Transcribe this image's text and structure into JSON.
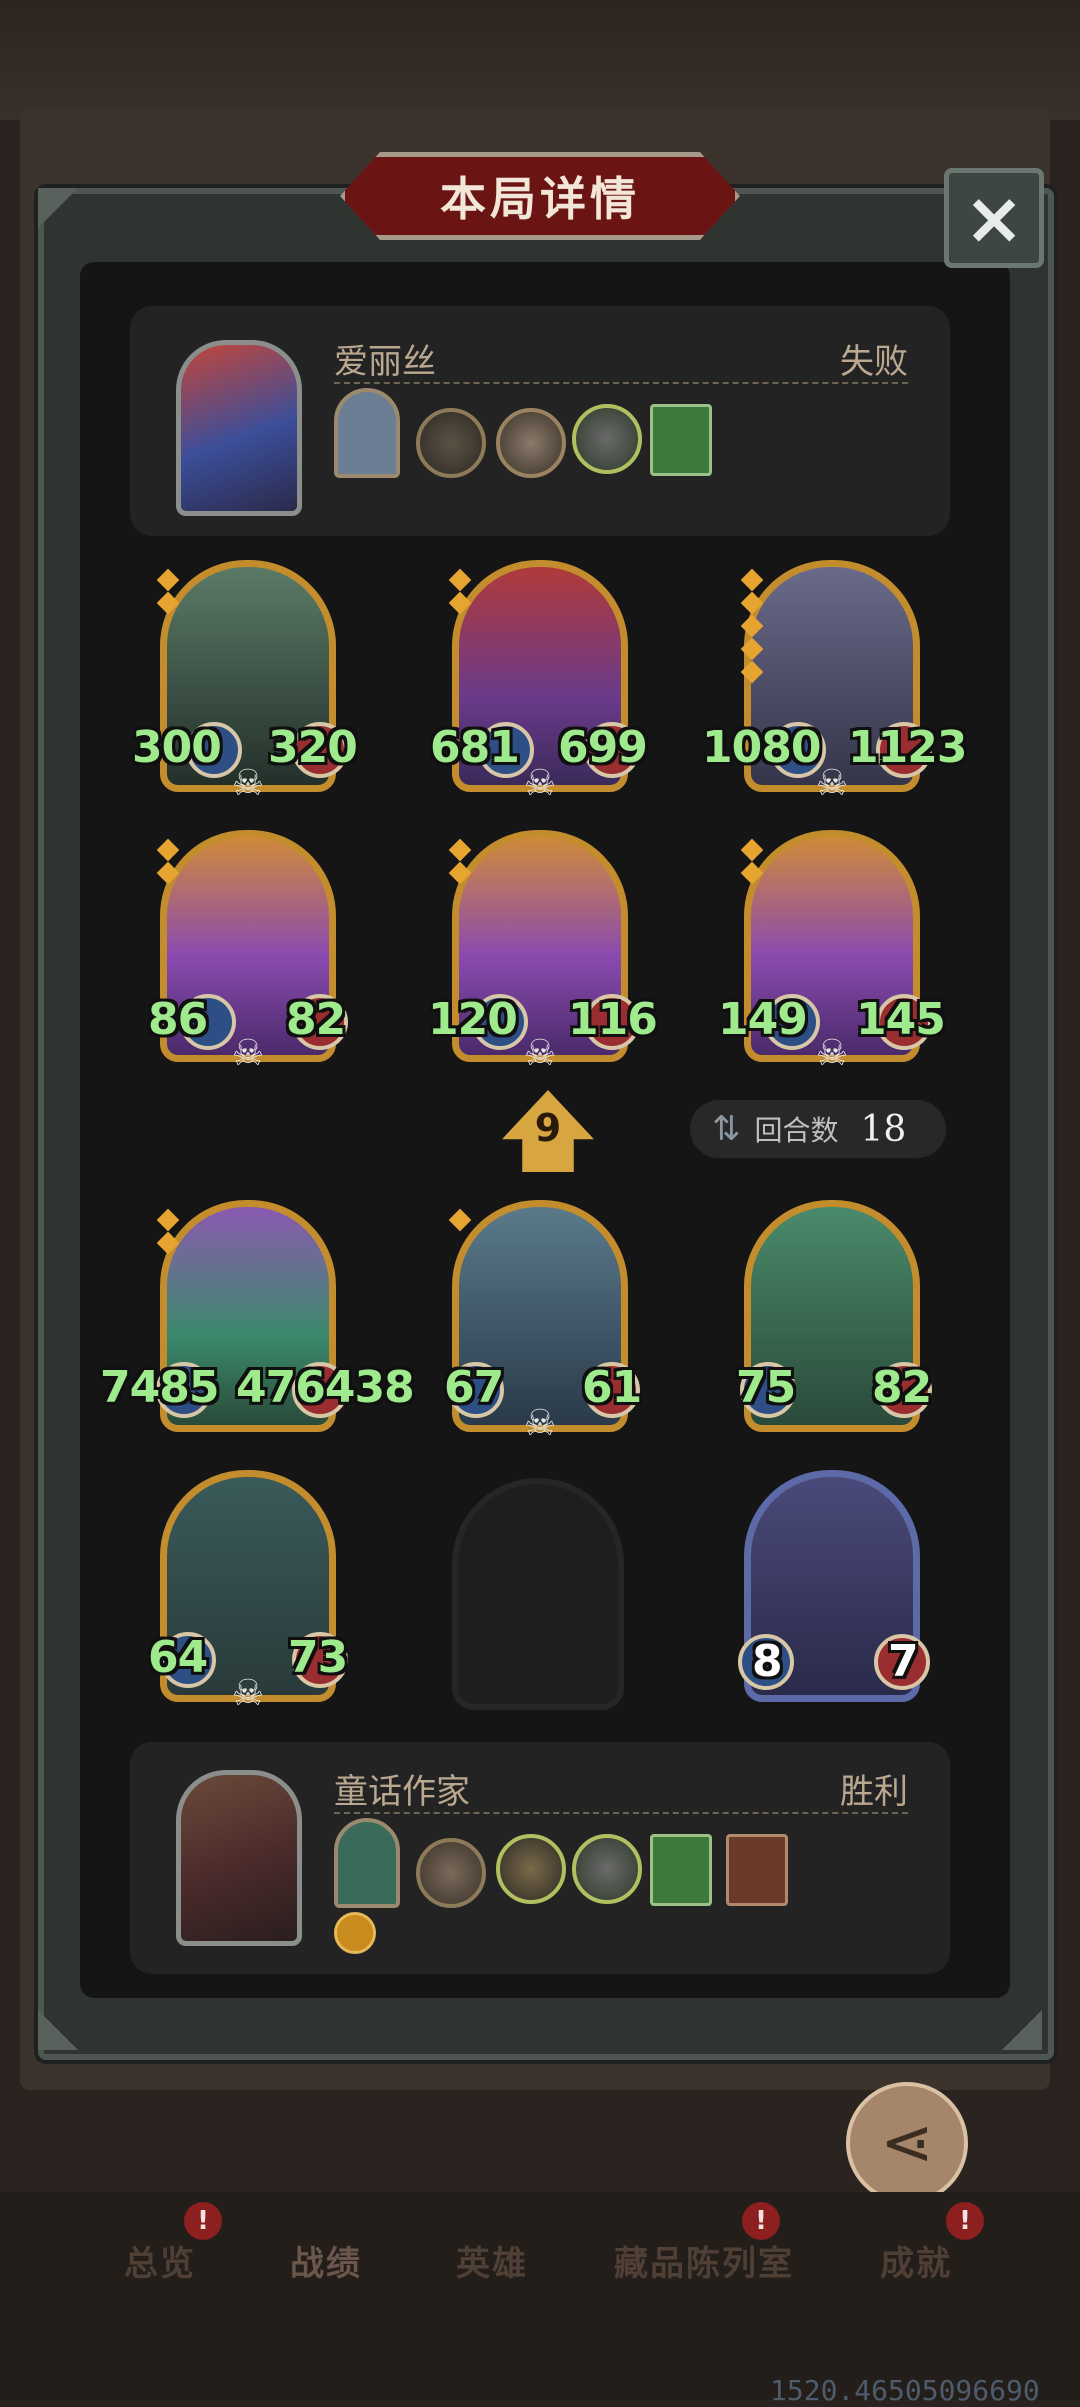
{
  "dialog": {
    "title": "本局详情",
    "close_icon": "×"
  },
  "opponent": {
    "name": "爱丽丝",
    "result": "失败"
  },
  "player": {
    "name": "童话作家",
    "result": "胜利"
  },
  "board_top": [
    {
      "atk": "300",
      "hp": "320"
    },
    {
      "atk": "681",
      "hp": "699"
    },
    {
      "atk": "1080",
      "hp": "1123"
    },
    {
      "atk": "86",
      "hp": "82"
    },
    {
      "atk": "120",
      "hp": "116"
    },
    {
      "atk": "149",
      "hp": "145"
    }
  ],
  "board_bottom": [
    {
      "atk": "7485",
      "hp": "476438"
    },
    {
      "atk": "67",
      "hp": "61"
    },
    {
      "atk": "75",
      "hp": "82"
    },
    {
      "atk": "64",
      "hp": "73"
    },
    {
      "atk": "8",
      "hp": "7"
    }
  ],
  "tavern_tier": "9",
  "round": {
    "label": "回合数",
    "value": "18"
  },
  "share": {
    "label": "分享"
  },
  "nav": {
    "overview": "总览",
    "records": "战绩",
    "heroes": "英雄",
    "collection": "藏品陈列室",
    "achievements": "成就",
    "badge": "!"
  },
  "version": "1520.46505096690",
  "colors": {
    "stat_text": "#9eea8c",
    "card_border": "#c38d2e",
    "title_bg": "#6b1414"
  }
}
